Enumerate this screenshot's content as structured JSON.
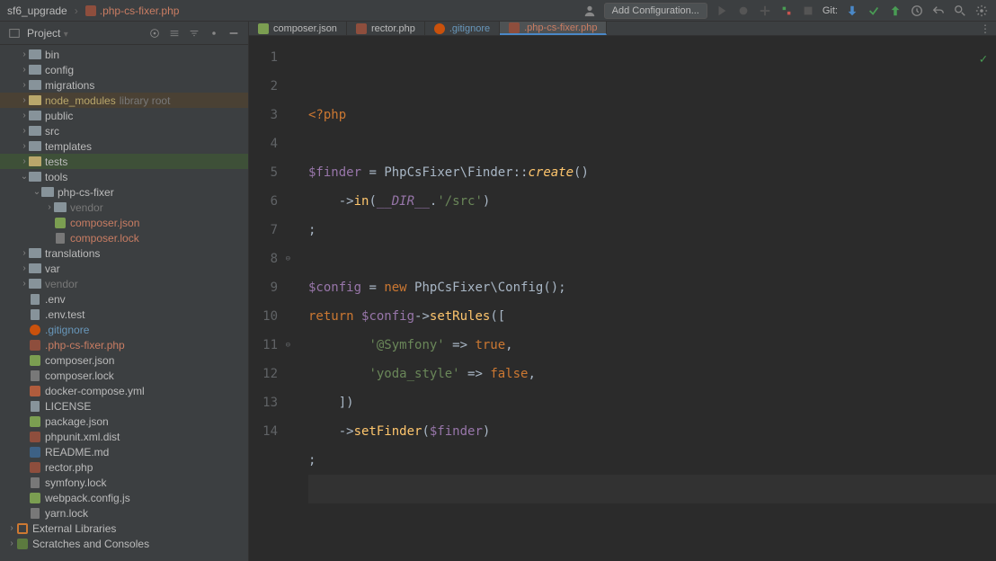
{
  "toolbar": {
    "project_name": "sf6_upgrade",
    "current_file": ".php-cs-fixer.php",
    "config_label": "Add Configuration...",
    "git_label": "Git:"
  },
  "sidebar": {
    "title": "Project",
    "items": [
      {
        "depth": 1,
        "arrow": "›",
        "icon": "folder",
        "label": "bin"
      },
      {
        "depth": 1,
        "arrow": "›",
        "icon": "folder",
        "label": "config"
      },
      {
        "depth": 1,
        "arrow": "›",
        "icon": "folder",
        "label": "migrations"
      },
      {
        "depth": 1,
        "arrow": "›",
        "icon": "folder-o",
        "label": "node_modules",
        "hint": "library root",
        "cls": "highlight-node",
        "labelCls": "yellow"
      },
      {
        "depth": 1,
        "arrow": "›",
        "icon": "folder",
        "label": "public"
      },
      {
        "depth": 1,
        "arrow": "›",
        "icon": "folder",
        "label": "src"
      },
      {
        "depth": 1,
        "arrow": "›",
        "icon": "folder",
        "label": "templates"
      },
      {
        "depth": 1,
        "arrow": "›",
        "icon": "folder-o",
        "label": "tests",
        "cls": "highlight-tests"
      },
      {
        "depth": 1,
        "arrow": "⌄",
        "icon": "folder",
        "label": "tools"
      },
      {
        "depth": 2,
        "arrow": "⌄",
        "icon": "folder",
        "label": "php-cs-fixer"
      },
      {
        "depth": 3,
        "arrow": "›",
        "icon": "folder",
        "label": "vendor",
        "labelCls": "dim"
      },
      {
        "depth": 3,
        "arrow": " ",
        "icon": "json",
        "label": "composer.json",
        "labelCls": "orange"
      },
      {
        "depth": 3,
        "arrow": " ",
        "icon": "lock",
        "label": "composer.lock",
        "labelCls": "orange"
      },
      {
        "depth": 1,
        "arrow": "›",
        "icon": "folder",
        "label": "translations"
      },
      {
        "depth": 1,
        "arrow": "›",
        "icon": "folder",
        "label": "var"
      },
      {
        "depth": 1,
        "arrow": "›",
        "icon": "folder",
        "label": "vendor",
        "labelCls": "dim"
      },
      {
        "depth": 1,
        "arrow": " ",
        "icon": "file",
        "label": ".env"
      },
      {
        "depth": 1,
        "arrow": " ",
        "icon": "file",
        "label": ".env.test"
      },
      {
        "depth": 1,
        "arrow": " ",
        "icon": "git",
        "label": ".gitignore",
        "labelCls": "blue"
      },
      {
        "depth": 1,
        "arrow": " ",
        "icon": "php",
        "label": ".php-cs-fixer.php",
        "labelCls": "orange"
      },
      {
        "depth": 1,
        "arrow": " ",
        "icon": "json",
        "label": "composer.json"
      },
      {
        "depth": 1,
        "arrow": " ",
        "icon": "lock",
        "label": "composer.lock"
      },
      {
        "depth": 1,
        "arrow": " ",
        "icon": "yml",
        "label": "docker-compose.yml"
      },
      {
        "depth": 1,
        "arrow": " ",
        "icon": "file",
        "label": "LICENSE"
      },
      {
        "depth": 1,
        "arrow": " ",
        "icon": "json",
        "label": "package.json"
      },
      {
        "depth": 1,
        "arrow": " ",
        "icon": "php",
        "label": "phpunit.xml.dist"
      },
      {
        "depth": 1,
        "arrow": " ",
        "icon": "md",
        "label": "README.md"
      },
      {
        "depth": 1,
        "arrow": " ",
        "icon": "php",
        "label": "rector.php"
      },
      {
        "depth": 1,
        "arrow": " ",
        "icon": "lock",
        "label": "symfony.lock"
      },
      {
        "depth": 1,
        "arrow": " ",
        "icon": "json",
        "label": "webpack.config.js"
      },
      {
        "depth": 1,
        "arrow": " ",
        "icon": "lock",
        "label": "yarn.lock"
      },
      {
        "depth": 0,
        "arrow": "›",
        "icon": "lib",
        "label": "External Libraries"
      },
      {
        "depth": 0,
        "arrow": "›",
        "icon": "scratch",
        "label": "Scratches and Consoles"
      }
    ]
  },
  "tabs": [
    {
      "icon": "json",
      "name": "composer.json"
    },
    {
      "icon": "php",
      "name": "rector.php"
    },
    {
      "icon": "git",
      "name": ".gitignore",
      "cls": "blue"
    },
    {
      "icon": "php",
      "name": ".php-cs-fixer.php",
      "cls": "orange",
      "active": true
    }
  ],
  "code": {
    "lines": 14,
    "tokens": [
      [
        {
          "t": "<?php",
          "c": "php-open"
        }
      ],
      [],
      [
        {
          "t": "$finder",
          "c": "var"
        },
        {
          "t": " = ",
          "c": "op"
        },
        {
          "t": "PhpCsFixer\\Finder",
          "c": "cls"
        },
        {
          "t": "::",
          "c": "op"
        },
        {
          "t": "create",
          "c": "fni"
        },
        {
          "t": "()",
          "c": "plain"
        }
      ],
      [
        {
          "t": "    ",
          "c": "plain"
        },
        {
          "t": "->",
          "c": "op"
        },
        {
          "t": "in",
          "c": "fn"
        },
        {
          "t": "(",
          "c": "plain"
        },
        {
          "t": "__DIR__",
          "c": "const"
        },
        {
          "t": ".",
          "c": "op"
        },
        {
          "t": "'/src'",
          "c": "str"
        },
        {
          "t": ")",
          "c": "plain"
        }
      ],
      [
        {
          "t": ";",
          "c": "plain"
        }
      ],
      [],
      [
        {
          "t": "$config",
          "c": "var"
        },
        {
          "t": " = ",
          "c": "op"
        },
        {
          "t": "new ",
          "c": "kw"
        },
        {
          "t": "PhpCsFixer\\Config",
          "c": "cls"
        },
        {
          "t": "();",
          "c": "plain"
        }
      ],
      [
        {
          "t": "return ",
          "c": "kw"
        },
        {
          "t": "$config",
          "c": "var"
        },
        {
          "t": "->",
          "c": "op"
        },
        {
          "t": "setRules",
          "c": "fn"
        },
        {
          "t": "([",
          "c": "plain"
        }
      ],
      [
        {
          "t": "        ",
          "c": "plain"
        },
        {
          "t": "'@Symfony'",
          "c": "str"
        },
        {
          "t": " => ",
          "c": "op"
        },
        {
          "t": "true",
          "c": "bool"
        },
        {
          "t": ",",
          "c": "plain"
        }
      ],
      [
        {
          "t": "        ",
          "c": "plain"
        },
        {
          "t": "'yoda_style'",
          "c": "str"
        },
        {
          "t": " => ",
          "c": "op"
        },
        {
          "t": "false",
          "c": "bool"
        },
        {
          "t": ",",
          "c": "plain"
        }
      ],
      [
        {
          "t": "    ])",
          "c": "plain"
        }
      ],
      [
        {
          "t": "    ",
          "c": "plain"
        },
        {
          "t": "->",
          "c": "op"
        },
        {
          "t": "setFinder",
          "c": "fn"
        },
        {
          "t": "(",
          "c": "plain"
        },
        {
          "t": "$finder",
          "c": "var"
        },
        {
          "t": ")",
          "c": "plain"
        }
      ],
      [
        {
          "t": ";",
          "c": "plain"
        }
      ],
      []
    ],
    "fold_markers": {
      "8": "⊖",
      "11": "⊖"
    }
  }
}
